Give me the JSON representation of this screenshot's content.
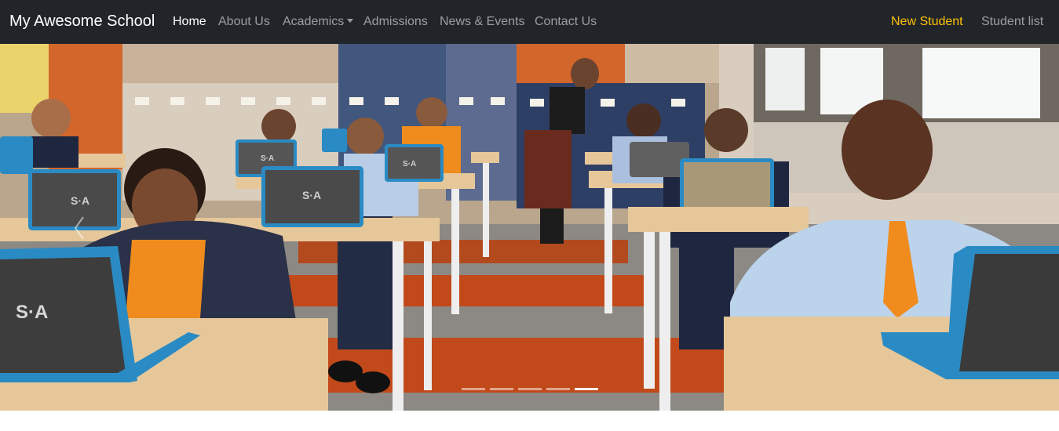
{
  "navbar": {
    "brand": "My Awesome School",
    "links": [
      {
        "label": "Home",
        "active": true
      },
      {
        "label": "About Us",
        "active": false
      },
      {
        "label": "Academics",
        "active": false,
        "dropdown": true
      },
      {
        "label": "Admissions",
        "active": false
      },
      {
        "label": "News & Events",
        "active": false
      },
      {
        "label": "Contact Us",
        "active": false
      }
    ],
    "right_links": [
      {
        "label": "New Student",
        "color": "#ffc107"
      },
      {
        "label": "Student list",
        "color": "rgba(255,255,255,0.55)"
      }
    ]
  },
  "carousel": {
    "image_alt": "Classroom with students using laptops",
    "laptop_logo": "S·A",
    "slide_count": 5,
    "active_index": 4,
    "controls": {
      "prev": "chevron-left-icon"
    }
  },
  "colors": {
    "navbar_bg": "#212529",
    "accent": "#ffc107",
    "uniform_orange": "#f08c1e",
    "floor_orange": "#c24a1a",
    "laptop_blue": "#2a8bc4",
    "desk_wood": "#e6c79a"
  }
}
